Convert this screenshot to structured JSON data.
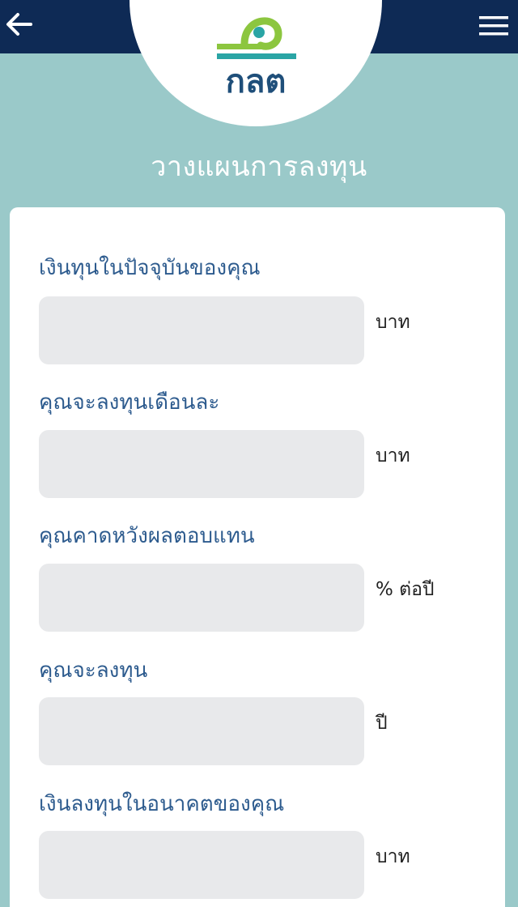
{
  "header": {
    "title": "วางแผนการลงทุน",
    "logo_text": "กลต",
    "back_icon": "arrow-left-icon",
    "menu_icon": "hamburger-menu-icon"
  },
  "colors": {
    "header_bg": "#0e2a55",
    "page_bg": "#9ac9c9",
    "logo_green": "#8cc63f",
    "logo_teal": "#2aa5a5",
    "logo_navy": "#1f4f7a",
    "label_color": "#2d5b8e",
    "input_bg": "#e8e9eb"
  },
  "form": {
    "fields": [
      {
        "label": "เงินทุนในปัจจุบันของคุณ",
        "value": "",
        "unit": "บาท"
      },
      {
        "label": "คุณจะลงทุนเดือนละ",
        "value": "",
        "unit": "บาท"
      },
      {
        "label": "คุณคาดหวังผลตอบแทน",
        "value": "",
        "unit": "% ต่อปี"
      },
      {
        "label": "คุณจะลงทุน",
        "value": "",
        "unit": "ปี"
      },
      {
        "label": "เงินลงทุนในอนาคตของคุณ",
        "value": "",
        "unit": "บาท"
      }
    ]
  }
}
